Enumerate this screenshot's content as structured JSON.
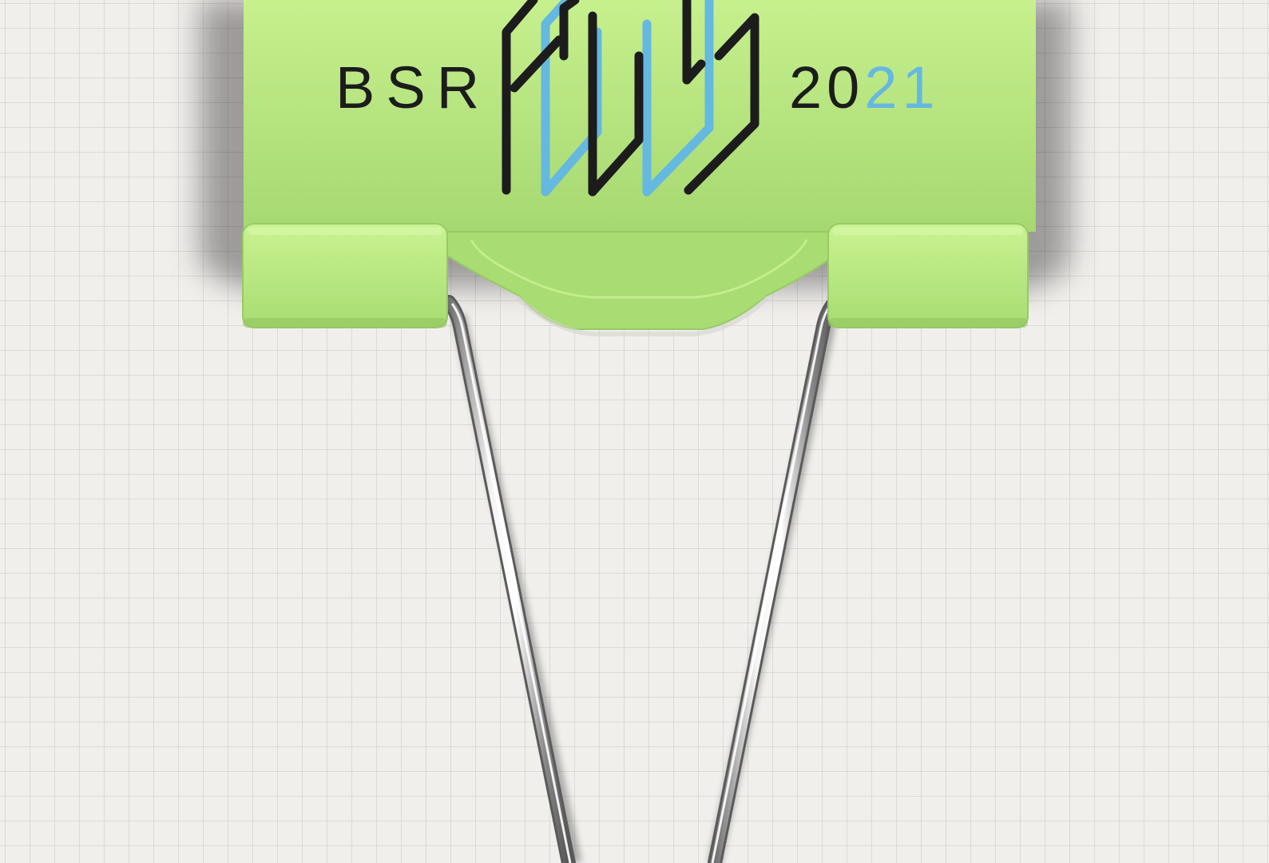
{
  "logo": {
    "left_text": "BSR",
    "mark_text": "FOCUS",
    "year_dark": "20",
    "year_accent": "21"
  },
  "colors": {
    "clip_green": "#b8e57f",
    "clip_green_dark": "#9fd469",
    "logo_black": "#1c1c1c",
    "logo_blue": "#65b8e0",
    "paper": "#f1efec"
  },
  "icons": {
    "logo_mark": "focus-monogram-icon",
    "clip": "binder-clip-icon"
  }
}
